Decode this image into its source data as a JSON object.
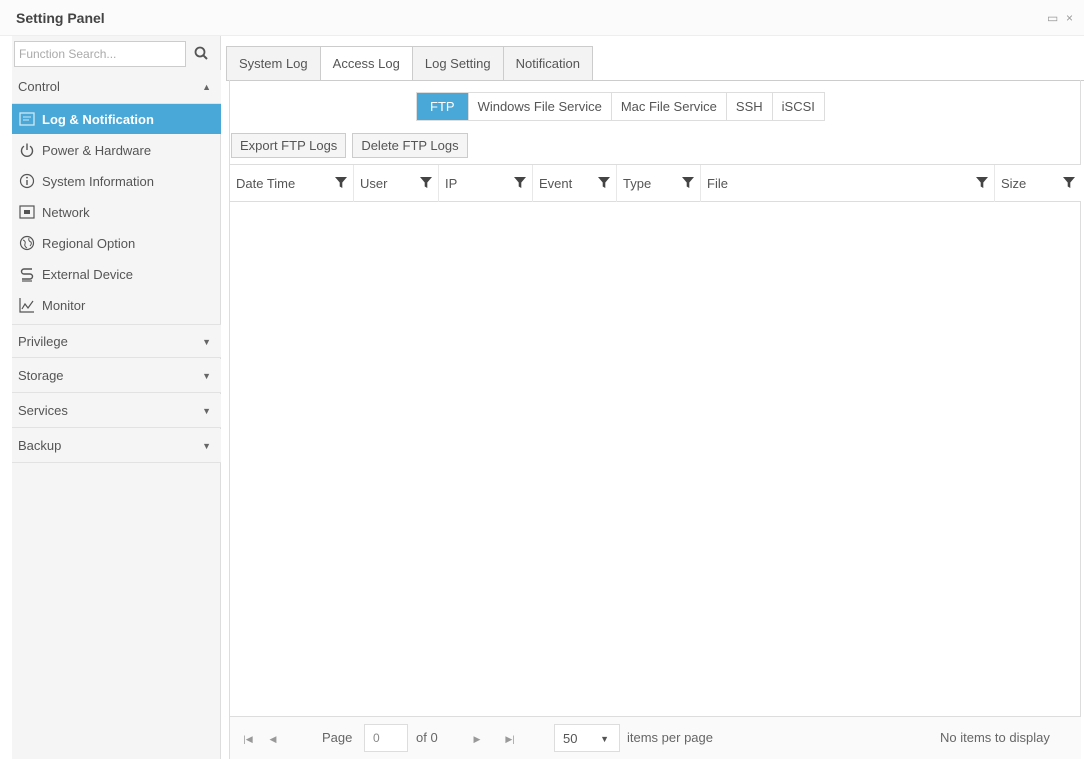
{
  "window": {
    "title": "Setting Panel",
    "restore_glyph": "▭",
    "close_glyph": "×"
  },
  "sidebar": {
    "search_placeholder": "Function Search...",
    "sections": {
      "control": "Control",
      "privilege": "Privilege",
      "storage": "Storage",
      "services": "Services",
      "backup": "Backup"
    },
    "items": [
      {
        "label": "Log & Notification",
        "icon": "log-icon",
        "active": true
      },
      {
        "label": "Power & Hardware",
        "icon": "power-icon"
      },
      {
        "label": "System Information",
        "icon": "info-icon"
      },
      {
        "label": "Network",
        "icon": "network-icon"
      },
      {
        "label": "Regional Option",
        "icon": "globe-icon"
      },
      {
        "label": "External Device",
        "icon": "usb-icon"
      },
      {
        "label": "Monitor",
        "icon": "chart-icon"
      }
    ]
  },
  "tabs": [
    "System Log",
    "Access Log",
    "Log Setting",
    "Notification"
  ],
  "active_tab": "Access Log",
  "subtabs": [
    "FTP",
    "Windows File Service",
    "Mac File Service",
    "SSH",
    "iSCSI"
  ],
  "active_subtab": "FTP",
  "actions": {
    "export": "Export FTP Logs",
    "delete": "Delete FTP Logs"
  },
  "columns": [
    "Date Time",
    "User",
    "IP",
    "Event",
    "Type",
    "File",
    "Size"
  ],
  "pager": {
    "page_label": "Page",
    "page_value": "0",
    "of_label": "of 0",
    "page_size": "50",
    "items_per_page": "items per page",
    "status": "No items to display"
  },
  "colors": {
    "accent": "#4aa8d8",
    "sidebar_bg": "#f5f5f5",
    "border": "#dddddd"
  }
}
